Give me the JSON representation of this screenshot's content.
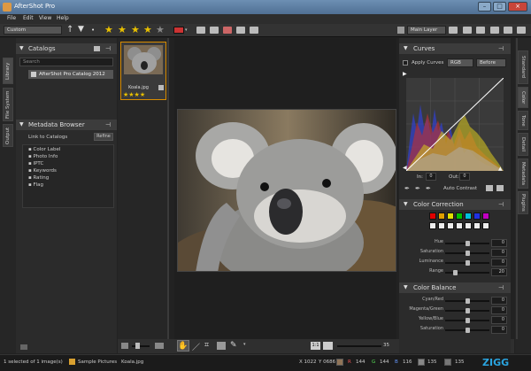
{
  "window": {
    "title": "AfterShot Pro",
    "min": "–",
    "max": "□",
    "close": "×"
  },
  "menu": [
    "File",
    "Edit",
    "View",
    "Help"
  ],
  "toolbar": {
    "preset": "Custom",
    "layer": "Main Layer",
    "stars": [
      "★",
      "★",
      "★",
      "★",
      "★"
    ]
  },
  "left_tabs": [
    "Library",
    "File System",
    "Output"
  ],
  "catalogs": {
    "title": "Catalogs",
    "search_placeholder": "Search",
    "item": "AfterShot Pro Catalog 2012"
  },
  "metadata": {
    "title": "Metadata Browser",
    "link": "Link to Catalogs",
    "refine": "Refine",
    "items": [
      "Color Label",
      "Photo Info",
      "IPTC",
      "Keywords",
      "Rating",
      "Flag"
    ]
  },
  "thumbnail": {
    "name": "Koala.jpg",
    "stars": "★★★★"
  },
  "right_tabs": [
    "Standard",
    "Color",
    "Tone",
    "Detail",
    "Metadata",
    "Plugins"
  ],
  "curves": {
    "title": "Curves",
    "apply_label": "Apply Curves",
    "channel": "RGB",
    "mode": "Before",
    "in_label": "In:",
    "in_value": "0",
    "out_label": "Out:",
    "out_value": "0",
    "auto_contrast": "Auto Contrast"
  },
  "color_correction": {
    "title": "Color Correction",
    "swatches": [
      "#e00000",
      "#e0a000",
      "#e0e000",
      "#00c000",
      "#00c0e0",
      "#2030e0",
      "#c000c0"
    ],
    "sliders": [
      {
        "label": "Hue",
        "value": "0",
        "pos": 0.5
      },
      {
        "label": "Saturation",
        "value": "0",
        "pos": 0.5
      },
      {
        "label": "Luminance",
        "value": "0",
        "pos": 0.5
      },
      {
        "label": "Range",
        "value": "20",
        "pos": 0.2
      }
    ]
  },
  "color_balance": {
    "title": "Color Balance",
    "sliders": [
      {
        "label": "Cyan/Red",
        "value": "0",
        "pos": 0.5
      },
      {
        "label": "Magenta/Green",
        "value": "0",
        "pos": 0.5
      },
      {
        "label": "Yellow/Blue",
        "value": "0",
        "pos": 0.5
      },
      {
        "label": "Saturation",
        "value": "0",
        "pos": 0.5
      }
    ]
  },
  "bottom": {
    "zoom": "35"
  },
  "status": {
    "selection": "1 selected of 1 image(s)",
    "folder": "Sample Pictures",
    "file": "Koala.jpg",
    "x": "X 1022",
    "y": "Y 0686",
    "r_label": "R",
    "r": "144",
    "g_label": "G",
    "g": "144",
    "b_label": "B",
    "b": "116",
    "k": "135",
    "coord": "135",
    "watermark": "ZIGG"
  }
}
